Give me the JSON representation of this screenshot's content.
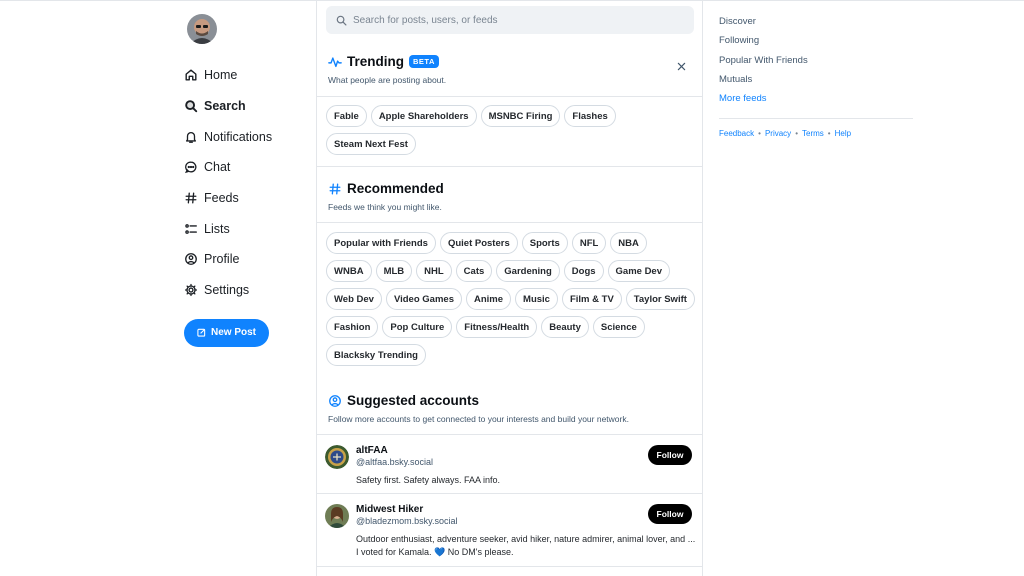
{
  "nav": {
    "items": [
      {
        "label": "Home",
        "icon": "home-icon"
      },
      {
        "label": "Search",
        "icon": "search-icon"
      },
      {
        "label": "Notifications",
        "icon": "bell-icon"
      },
      {
        "label": "Chat",
        "icon": "chat-icon"
      },
      {
        "label": "Feeds",
        "icon": "hash-icon"
      },
      {
        "label": "Lists",
        "icon": "list-icon"
      },
      {
        "label": "Profile",
        "icon": "person-circle-icon"
      },
      {
        "label": "Settings",
        "icon": "gear-icon"
      }
    ],
    "active": "Search",
    "new_post_label": "New Post"
  },
  "search": {
    "placeholder": "Search for posts, users, or feeds"
  },
  "trending": {
    "title": "Trending",
    "badge": "BETA",
    "subtitle": "What people are posting about.",
    "topics": [
      "Fable",
      "Apple Shareholders",
      "MSNBC Firing",
      "Flashes",
      "Steam Next Fest"
    ]
  },
  "recommended": {
    "title": "Recommended",
    "subtitle": "Feeds we think you might like.",
    "feeds": [
      "Popular with Friends",
      "Quiet Posters",
      "Sports",
      "NFL",
      "NBA",
      "WNBA",
      "MLB",
      "NHL",
      "Cats",
      "Gardening",
      "Dogs",
      "Game Dev",
      "Web Dev",
      "Video Games",
      "Anime",
      "Music",
      "Film & TV",
      "Taylor Swift",
      "Fashion",
      "Pop Culture",
      "Fitness/Health",
      "Beauty",
      "Science",
      "Blacksky Trending"
    ]
  },
  "suggested": {
    "title": "Suggested accounts",
    "subtitle": "Follow more accounts to get connected to your interests and build your network.",
    "accounts": [
      {
        "name": "altFAA",
        "handle": "@altfaa.bsky.social",
        "bio": "Safety first. Safety always. FAA info.",
        "follow_label": "Follow"
      },
      {
        "name": "Midwest Hiker",
        "handle": "@bladezmom.bsky.social",
        "bio": "Outdoor enthusiast, adventure seeker, avid hiker, nature admirer, animal lover, and ... I voted for Kamala. 💙 No DM's please.",
        "follow_label": "Follow"
      }
    ]
  },
  "right": {
    "feeds": [
      "Discover",
      "Following",
      "Popular With Friends",
      "Mutuals"
    ],
    "more_feeds": "More feeds",
    "footer": [
      "Feedback",
      "Privacy",
      "Terms",
      "Help"
    ],
    "footer_sep": "•"
  },
  "colors": {
    "accent": "#1083fe",
    "text_muted": "#42576c",
    "border": "#e3e6ea",
    "follow_bg": "#000000"
  }
}
